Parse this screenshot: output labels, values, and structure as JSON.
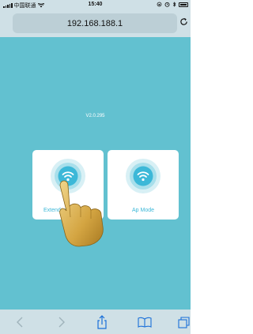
{
  "status_bar": {
    "carrier": "中国联通",
    "time": "15:40",
    "icons": [
      "signal-icon",
      "wifi-icon",
      "rotation-lock-icon",
      "alarm-icon",
      "bluetooth-icon",
      "battery-icon"
    ]
  },
  "browser": {
    "address": "192.168.188.1",
    "reload_icon": "reload-icon"
  },
  "page": {
    "version": "V2.0.295",
    "modes": [
      {
        "label": "Extender",
        "icon": "wifi-icon"
      },
      {
        "label": "Ap Mode",
        "icon": "wifi-icon"
      }
    ]
  },
  "toolbar": {
    "buttons": [
      "back-icon",
      "forward-icon",
      "share-icon",
      "bookmarks-icon",
      "tabs-icon"
    ]
  },
  "colors": {
    "page_background": "#62c1d0",
    "accent": "#3cb8d8",
    "browser_chrome": "#cfe0e6"
  }
}
